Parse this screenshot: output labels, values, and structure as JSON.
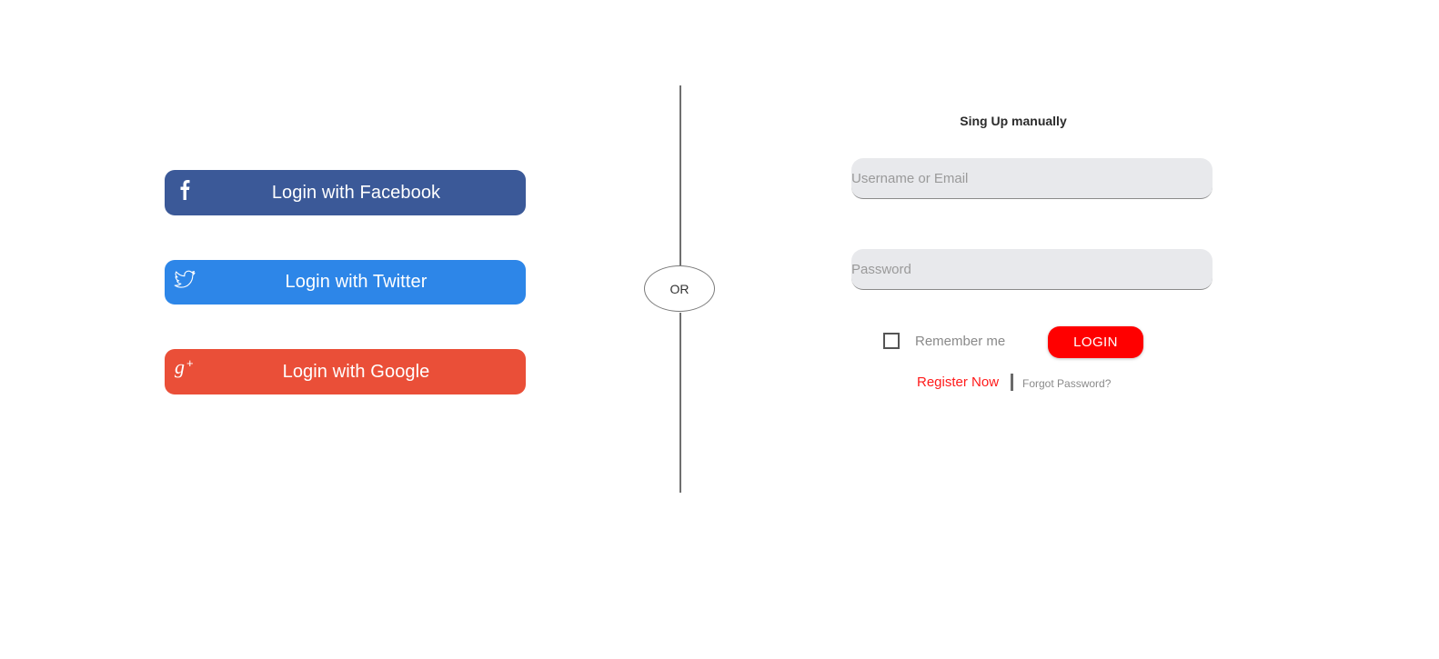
{
  "social_login": {
    "facebook": {
      "label": "Login with Facebook",
      "icon": "facebook-icon",
      "color": "#3b5998"
    },
    "twitter": {
      "label": "Login with Twitter",
      "icon": "twitter-icon",
      "color": "#2d86e8"
    },
    "google": {
      "label": "Login with Google",
      "icon": "google-plus-icon",
      "color": "#ea4f38"
    }
  },
  "divider": {
    "label": "OR"
  },
  "manual_form": {
    "title": "Sing Up manually",
    "username_placeholder": "Username or Email",
    "password_placeholder": "Password",
    "remember_label": "Remember me",
    "login_label": "LOGIN",
    "register_label": "Register Now",
    "forgot_label": "Forgot Password?",
    "accent_color": "#ff0000"
  }
}
